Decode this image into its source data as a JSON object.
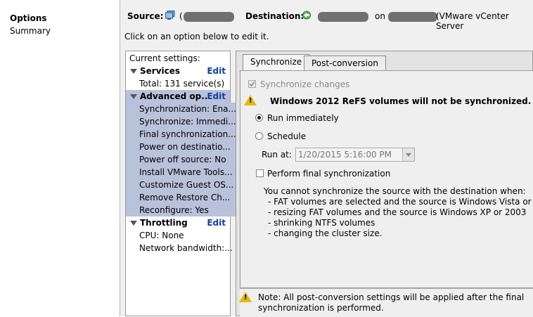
{
  "nav": {
    "items": [
      {
        "label": "Options"
      },
      {
        "label": "Summary"
      }
    ]
  },
  "header": {
    "source_label": "Source:",
    "source_prefix": "(",
    "destination_label": "Destination:",
    "on_text": "on",
    "destination_suffix": "(VMware vCenter Server",
    "instruction": "Click on an option below to edit it."
  },
  "settings": {
    "title": "Current settings:",
    "edit_label": "Edit",
    "groups": [
      {
        "label": "Services",
        "items": [
          "Total: 131 service(s)"
        ]
      },
      {
        "label": "Advanced op...",
        "items": [
          "Synchronization: Ena...",
          "Synchronize: Immedi...",
          "Final synchronization...",
          "Power on destinatio...",
          "Power off source: No",
          "Install VMware Tools...",
          "Customize Guest OS...",
          "Remove Restore Ch...",
          "Reconfigure: Yes"
        ]
      },
      {
        "label": "Throttling",
        "items": [
          "CPU: None",
          "Network bandwidth:..."
        ]
      }
    ]
  },
  "tabs": [
    {
      "label": "Synchronize"
    },
    {
      "label": "Post-conversion"
    }
  ],
  "sync": {
    "sync_changes_label": "Synchronize changes",
    "warning": "Windows 2012 ReFS volumes will not be synchronized.",
    "run_immediately": "Run immediately",
    "schedule": "Schedule",
    "run_at_label": "Run at:",
    "run_at_value": "1/20/2015 5:16:00 PM",
    "final_sync_label": "Perform final synchronization",
    "info_lines": [
      "You cannot synchronize the source with the destination when:",
      "- FAT volumes are selected and the source is Windows Vista or later",
      "- resizing FAT volumes and the source is Windows XP or 2003",
      "- shrinking NTFS volumes",
      "- changing the cluster size."
    ]
  },
  "note": {
    "line1": "Note: All post-conversion settings will be applied after the final",
    "line2": "synchronization is performed."
  }
}
